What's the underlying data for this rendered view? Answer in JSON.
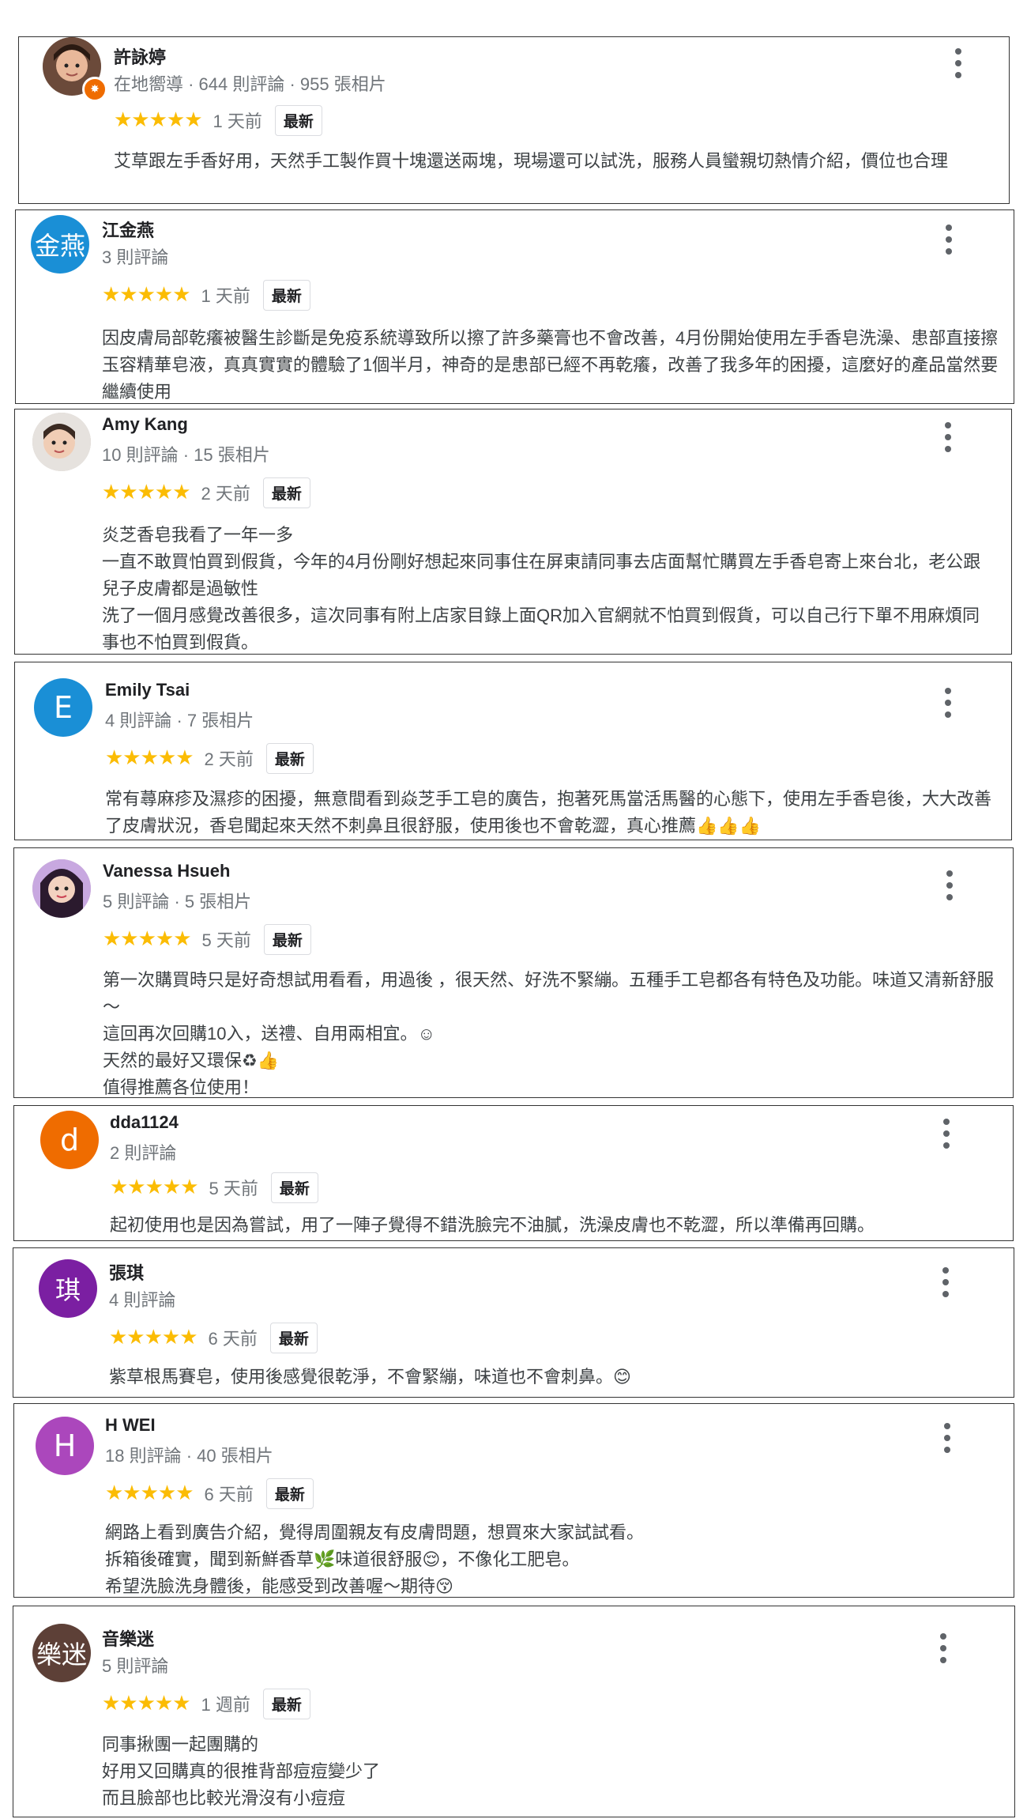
{
  "reviews": [
    {
      "name": "許詠婷",
      "meta": "在地嚮導 · 644 則評論 · 955 張相片",
      "stars": "★★★★★",
      "when": "1 天前",
      "badge": "最新",
      "text": "艾草跟左手香好用，天然手工製作買十塊還送兩塊，現場還可以試洗，服務人員蠻親切熱情介紹，價位也合理",
      "avatar": {
        "type": "photo",
        "color": "#c9a48c"
      }
    },
    {
      "name": "江金燕",
      "meta": "3 則評論",
      "stars": "★★★★★",
      "when": "1 天前",
      "badge": "最新",
      "text": "因皮膚局部乾癢被醫生診斷是免疫系統導致所以擦了許多藥膏也不會改善，4月份開始使用左手香皂洗澡、患部直接擦玉容精華皂液，真真實實的體驗了1個半月，神奇的是患部已經不再乾癢，改善了我多年的困擾，這麼好的產品當然要繼續使用",
      "avatar": {
        "type": "text",
        "label": "金燕",
        "color": "#1a8fd6"
      }
    },
    {
      "name": "Amy Kang",
      "meta": "10 則評論 · 15 張相片",
      "stars": "★★★★★",
      "when": "2 天前",
      "badge": "最新",
      "text": "炎芝香皂我看了一年一多\n一直不敢買怕買到假貨，今年的4月份剛好想起來同事住在屏東請同事去店面幫忙購買左手香皂寄上來台北，老公跟兒子皮膚都是過敏性\n洗了一個月感覺改善很多，這次同事有附上店家目錄上面QR加入官網就不怕買到假貨，可以自己行下單不用麻煩同事也不怕買到假貨。",
      "avatar": {
        "type": "photo",
        "color": "#d8d2cc"
      }
    },
    {
      "name": "Emily Tsai",
      "meta": "4 則評論 · 7 張相片",
      "stars": "★★★★★",
      "when": "2 天前",
      "badge": "最新",
      "text": "常有蕁麻疹及濕疹的困擾，無意間看到焱芝手工皂的廣告，抱著死馬當活馬醫的心態下，使用左手香皂後，大大改善了皮膚狀況，香皂聞起來天然不刺鼻且很舒服，使用後也不會乾澀，真心推薦👍👍👍",
      "avatar": {
        "type": "letter",
        "label": "E",
        "color": "#1a8fd6"
      }
    },
    {
      "name": "Vanessa Hsueh",
      "meta": "5 則評論 · 5 張相片",
      "stars": "★★★★★",
      "when": "5 天前",
      "badge": "最新",
      "text": "第一次購買時只是好奇想試用看看，用過後 ，很天然、好洗不緊繃。五種手工皂都各有特色及功能。味道又清新舒服～\n這回再次回購10入，送禮、自用兩相宜。☺\n天然的最好又環保♻👍\n值得推薦各位使用！",
      "avatar": {
        "type": "photo",
        "color": "#b59ad0"
      }
    },
    {
      "name": "dda1124",
      "meta": "2 則評論",
      "stars": "★★★★★",
      "when": "5 天前",
      "badge": "最新",
      "text": "起初使用也是因為嘗試，用了一陣子覺得不錯洗臉完不油膩，洗澡皮膚也不乾澀，所以準備再回購。",
      "avatar": {
        "type": "letter",
        "label": "d",
        "color": "#ef6c00"
      }
    },
    {
      "name": "張琪",
      "meta": "4 則評論",
      "stars": "★★★★★",
      "when": "6 天前",
      "badge": "最新",
      "text": "紫草根馬賽皂，使用後感覺很乾淨，不會緊繃，味道也不會刺鼻。😊",
      "avatar": {
        "type": "text",
        "label": "琪",
        "color": "#7b1fa2"
      }
    },
    {
      "name": "H WEI",
      "meta": "18 則評論 · 40 張相片",
      "stars": "★★★★★",
      "when": "6 天前",
      "badge": "最新",
      "text": "網路上看到廣告介紹，覺得周圍親友有皮膚問題，想買來大家試試看。\n拆箱後確實，聞到新鮮香草🌿味道很舒服😌，不像化工肥皂。\n希望洗臉洗身體後，能感受到改善喔～期待😚",
      "avatar": {
        "type": "letter",
        "label": "H",
        "color": "#ab47bc"
      }
    },
    {
      "name": "音樂迷",
      "meta": "5 則評論",
      "stars": "★★★★★",
      "when": "1 週前",
      "badge": "最新",
      "text": "同事揪團一起團購的\n好用又回購真的很推背部痘痘變少了\n而且臉部也比較光滑沒有小痘痘",
      "avatar": {
        "type": "text",
        "label": "樂迷",
        "color": "#5d4037"
      }
    }
  ]
}
